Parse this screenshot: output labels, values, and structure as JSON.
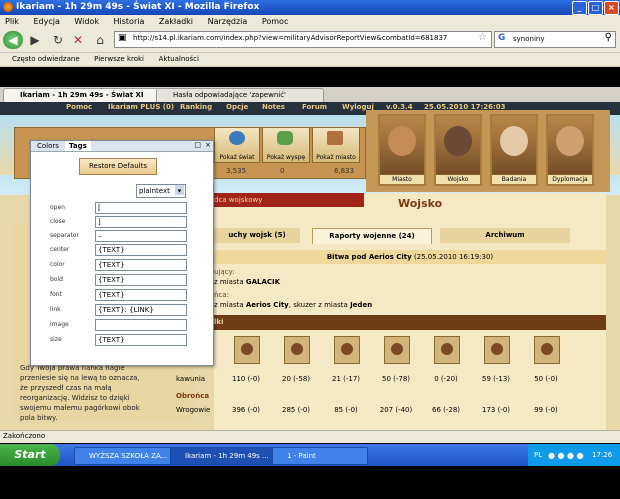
{
  "window": {
    "title": "Ikariam - 1h 29m 49s - Świat XI - Mozilla Firefox"
  },
  "menu": [
    "Plik",
    "Edycja",
    "Widok",
    "Historia",
    "Zakładki",
    "Narzędzia",
    "Pomoc"
  ],
  "address": {
    "url": "http://s14.pl.ikariam.com/index.php?view=militaryAdvisorReportView&combatId=681837"
  },
  "search": {
    "value": "synoniny"
  },
  "bookmarks": [
    "Często odwiedzane",
    "Pierwsze kroki",
    "Aktualności"
  ],
  "tabs": [
    {
      "label": "Ikariam - 1h 29m 49s - Świat XI"
    },
    {
      "label": "Hasła odpowiadające 'zapewnić'"
    }
  ],
  "game_nav": {
    "items": [
      "Pomoc",
      "Ikariam PLUS (0)",
      "Ranking",
      "Opcje",
      "Notes",
      "Forum",
      "Wyloguj"
    ],
    "version": "v.0.3.4",
    "datetime": "25.05.2010 17:26:03"
  },
  "game_buttons": [
    "Pokaż świat",
    "Pokaż wyspę",
    "Pokaż miasto"
  ],
  "advisors": [
    "Miasto",
    "Wojsko",
    "Badania",
    "Dyplomacja"
  ],
  "resources": {
    "wood": "3,535",
    "marble": "0",
    "wine": "6,833"
  },
  "banner": "dca wojskowy",
  "section_title": "Wojsko",
  "subtabs": [
    "uchy wojsk (5)",
    "Raporty wojenne (24)",
    "Archiwum"
  ],
  "battle": {
    "title": "Bitwa pod Aerios City",
    "time": "(25.05.2010 16:19:30)",
    "attacker_label": "ujący:",
    "attacker_from": "z miasta",
    "attacker_city": "GALACIK",
    "defender_label": "ńca:",
    "defender_from": "z miasta",
    "defender_city": "Aerios City",
    "defender_mid": ", skuzer z miasta",
    "defender_player": "Jeden",
    "units_heading": "lki"
  },
  "rows": [
    {
      "label": "kawunia",
      "values": [
        "110 (-0)",
        "20 (-58)",
        "21 (-17)",
        "50 (-78)",
        "0 (-20)",
        "59 (-13)",
        "50 (-0)"
      ]
    },
    {
      "label": "Obrońca",
      "values": []
    },
    {
      "label": "Wrogowie",
      "values": [
        "396 (-0)",
        "285 (-0)",
        "85 (-0)",
        "207 (-40)",
        "66 (-28)",
        "173 (-0)",
        "99 (-0)"
      ]
    }
  ],
  "story": "Gdy Twoja prawa flanka nagle przeniesie się na lewą to oznacza, że przyszedł czas na małą reorganizację. Widzisz to dzięki swojemu małemu pagórkowi obok pola bitwy.",
  "dialog": {
    "tabs": [
      "Colors",
      "Tags"
    ],
    "restore": "Restore Defaults",
    "select": "plaintext",
    "fields": [
      {
        "label": "open",
        "value": "["
      },
      {
        "label": "close",
        "value": "]"
      },
      {
        "label": "separator",
        "value": "–"
      },
      {
        "label": "center",
        "value": "{TEXT}"
      },
      {
        "label": "color",
        "value": "{TEXT}"
      },
      {
        "label": "bold",
        "value": "{TEXT}"
      },
      {
        "label": "font",
        "value": "{TEXT}"
      },
      {
        "label": "link",
        "value": "{TEXT}: {LINK}"
      },
      {
        "label": "image",
        "value": ""
      },
      {
        "label": "size",
        "value": "{TEXT}"
      }
    ]
  },
  "status": "Zakończono",
  "taskbar": {
    "start": "Start",
    "tasks": [
      "WYŻSZA SZKOŁA ZA...",
      "Ikariam - 1h 29m 49s ...",
      "1 - Paint"
    ],
    "lang": "PL",
    "clock": "17:26"
  }
}
